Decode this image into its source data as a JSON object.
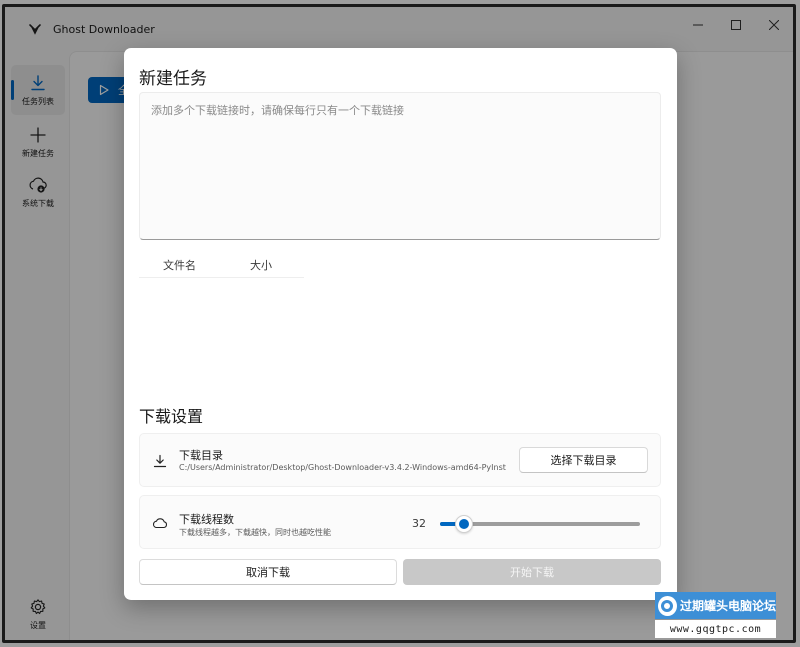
{
  "window": {
    "title": "Ghost Downloader",
    "controls": {
      "minimize": "minimize-icon",
      "maximize": "maximize-icon",
      "close": "close-icon"
    }
  },
  "sidebar": {
    "items": [
      {
        "label": "任务列表",
        "icon": "download-icon",
        "active": true
      },
      {
        "label": "新建任务",
        "icon": "plus-icon",
        "active": false
      },
      {
        "label": "系统下载",
        "icon": "cloud-download-icon",
        "active": false
      }
    ],
    "settings_label": "设置"
  },
  "content": {
    "start_all_label": "全"
  },
  "dialog": {
    "title": "新建任务",
    "url_placeholder": "添加多个下载链接时，请确保每行只有一个下载链接",
    "table": {
      "columns": [
        "文件名",
        "大小"
      ]
    },
    "settings_title": "下载设置",
    "download_dir": {
      "title": "下载目录",
      "path": "C:/Users/Administrator/Desktop/Ghost-Downloader-v3.4.2-Windows-amd64-PyInst",
      "button_label": "选择下载目录"
    },
    "threads": {
      "title": "下载线程数",
      "description": "下载线程越多，下载越快，同时也越吃性能",
      "value": "32",
      "fraction": 0.12
    },
    "cancel_label": "取消下载",
    "start_label": "开始下载"
  },
  "watermark": {
    "name": "过期罐头电脑论坛",
    "url": "www.gqgtpc.com"
  },
  "colors": {
    "accent": "#0067c0",
    "disabled": "#c8c8c8",
    "watermark": "#3d8fd6"
  }
}
